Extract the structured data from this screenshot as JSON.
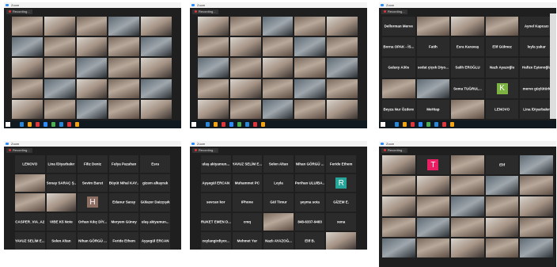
{
  "window_title": "Zoom",
  "recording_label": "Recording...",
  "colors": {
    "zoom_blue": "#2d8cff",
    "record_red": "#e0353b",
    "tile_bg": "#2b2b2b",
    "app_bg": "#1f1f1f"
  },
  "shots": [
    {
      "tiles": [
        {
          "t": "vid"
        },
        {
          "t": "vid",
          "alt": "alt"
        },
        {
          "t": "vid"
        },
        {
          "t": "vid",
          "alt": "dark"
        },
        {
          "t": "vid",
          "alt": "alt"
        },
        {
          "t": "vid",
          "alt": "dark"
        },
        {
          "t": "vid"
        },
        {
          "t": "vid",
          "alt": "alt"
        },
        {
          "t": "vid"
        },
        {
          "t": "vid",
          "alt": "dark"
        },
        {
          "t": "vid",
          "alt": "alt"
        },
        {
          "t": "vid"
        },
        {
          "t": "vid",
          "alt": "dark"
        },
        {
          "t": "vid"
        },
        {
          "t": "vid",
          "alt": "alt"
        },
        {
          "t": "vid"
        },
        {
          "t": "vid",
          "alt": "dark"
        },
        {
          "t": "vid",
          "alt": "alt"
        },
        {
          "t": "vid"
        },
        {
          "t": "vid",
          "alt": "dark"
        },
        {
          "t": "vid",
          "alt": "alt"
        },
        {
          "t": "vid"
        },
        {
          "t": "vid",
          "alt": "dark"
        },
        {
          "t": "vid"
        },
        {
          "t": "vid",
          "alt": "alt"
        }
      ]
    },
    {
      "tiles": [
        {
          "t": "vid",
          "alt": "alt"
        },
        {
          "t": "vid"
        },
        {
          "t": "vid",
          "alt": "dark"
        },
        {
          "t": "vid"
        },
        {
          "t": "vid",
          "alt": "alt"
        },
        {
          "t": "vid"
        },
        {
          "t": "vid",
          "alt": "alt"
        },
        {
          "t": "vid"
        },
        {
          "t": "vid",
          "alt": "dark"
        },
        {
          "t": "vid"
        },
        {
          "t": "vid",
          "alt": "dark"
        },
        {
          "t": "vid"
        },
        {
          "t": "vid",
          "alt": "alt"
        },
        {
          "t": "vid"
        },
        {
          "t": "vid",
          "alt": "dark"
        },
        {
          "t": "vid"
        },
        {
          "t": "vid",
          "alt": "alt"
        },
        {
          "t": "vid"
        },
        {
          "t": "vid",
          "alt": "dark"
        },
        {
          "t": "vid"
        },
        {
          "t": "vid",
          "alt": "alt"
        },
        {
          "t": "vid"
        },
        {
          "t": "vid",
          "alt": "dark"
        },
        {
          "t": "vid"
        },
        {
          "t": "vid",
          "alt": "alt"
        }
      ]
    },
    {
      "tiles": [
        {
          "name": "Dellorman Merve"
        },
        {
          "t": "vid"
        },
        {
          "t": "vid",
          "alt": "alt"
        },
        {
          "t": "vid"
        },
        {
          "name": "Aynel Kapcacı"
        },
        {
          "name": "Borna OPAK - İS..."
        },
        {
          "name": "Fatih"
        },
        {
          "name": "Esra Karavaş"
        },
        {
          "name": "Elif Gülmez"
        },
        {
          "name": "leyla yakar"
        },
        {
          "name": "Galaxy A30s"
        },
        {
          "name": "sedat çiçek Diyo..."
        },
        {
          "name": "Salih EROĞLU"
        },
        {
          "name": "Nazlı Ayazoğlu"
        },
        {
          "name": "Hafize Eştenoğlu"
        },
        {
          "t": "vid"
        },
        {
          "t": "vid",
          "alt": "dark"
        },
        {
          "name": "Sema TUĞRUL..."
        },
        {
          "avatar": "K",
          "color": "#7cb342"
        },
        {
          "name": "merve güçlütürk"
        },
        {
          "name": "Beyza Nur Özdere"
        },
        {
          "name": "MeHtap"
        },
        {
          "t": "vid"
        },
        {
          "name": "LENOVO"
        },
        {
          "name": "Lina /Diyarbakır"
        }
      ]
    },
    {
      "tiles": [
        {
          "name": "LENOVO"
        },
        {
          "name": "Lina /Diyarbakır"
        },
        {
          "name": "Filiz Deniz"
        },
        {
          "name": "Fulya Pazahan"
        },
        {
          "name": "Esra"
        },
        {
          "t": "vid"
        },
        {
          "name": "Sonay SARAÇ Ş..."
        },
        {
          "name": "Sevim Barut"
        },
        {
          "name": "Büyüt Nihal KAY..."
        },
        {
          "name": "gizem alkayrak"
        },
        {
          "t": "vid"
        },
        {
          "t": "vid",
          "alt": "alt"
        },
        {
          "avatar": "H",
          "color": "#8d6e63"
        },
        {
          "name": "Edanur Saray"
        },
        {
          "name": "Gülazer Daizçışık"
        },
        {
          "name": "CASPER_VIA_A2"
        },
        {
          "name": "VIBE K5 Note"
        },
        {
          "name": "Orhan Kılıç DİY..."
        },
        {
          "name": "Meryem Güney"
        },
        {
          "name": "ulaş akiyamun..."
        },
        {
          "name": "YAVUZ SELİM E..."
        },
        {
          "name": "Selen Altan"
        },
        {
          "name": "Nihan GÖRGÜ ..."
        },
        {
          "name": "Feride Ethem"
        },
        {
          "name": "Ayşegül ERCAN"
        }
      ]
    },
    {
      "tiles": [
        {
          "name": "ulaş akiyamun..."
        },
        {
          "name": "YAVUZ SELİM E..."
        },
        {
          "name": "Selen Altan"
        },
        {
          "name": "Nihan GÖRGÜ ..."
        },
        {
          "name": "Feride Ethem"
        },
        {
          "name": "Ayşegül ERCAN"
        },
        {
          "name": "Muhammet PC"
        },
        {
          "name": "Leyla"
        },
        {
          "name": "Perihan ULU/BA..."
        },
        {
          "avatar": "R",
          "color": "#26a69a"
        },
        {
          "name": "sevcan kor"
        },
        {
          "name": "iPhone"
        },
        {
          "name": "Gül Timur"
        },
        {
          "name": "şeyma sota"
        },
        {
          "name": "GİZEM E."
        },
        {
          "name": "RUKET EMEN D..."
        },
        {
          "name": "cmq"
        },
        {
          "t": "vid"
        },
        {
          "name": "848-6337-9483"
        },
        {
          "name": "xena"
        },
        {
          "name": "ceylangirdiyor..."
        },
        {
          "name": "Mehmet Yur"
        },
        {
          "name": "Nazlı AYAZOĞ..."
        },
        {
          "name": "Elif B."
        },
        {
          "t": "vid",
          "alt": "alt"
        }
      ]
    },
    {
      "tiles": [
        {
          "t": "vid",
          "alt": "alt"
        },
        {
          "avatar": "T",
          "color": "#e91e63"
        },
        {
          "t": "vid"
        },
        {
          "name": "Elif"
        },
        {
          "t": "vid",
          "alt": "dark"
        },
        {
          "t": "vid"
        },
        {
          "t": "vid",
          "alt": "alt"
        },
        {
          "t": "vid"
        },
        {
          "t": "vid",
          "alt": "dark"
        },
        {
          "t": "vid"
        },
        {
          "t": "vid",
          "alt": "alt"
        },
        {
          "t": "vid"
        },
        {
          "t": "vid",
          "alt": "dark"
        },
        {
          "t": "vid"
        },
        {
          "t": "vid",
          "alt": "alt"
        },
        {
          "t": "vid"
        },
        {
          "t": "vid",
          "alt": "dark"
        },
        {
          "t": "vid"
        },
        {
          "t": "vid",
          "alt": "alt"
        },
        {
          "t": "vid"
        },
        {
          "t": "vid",
          "alt": "dark"
        },
        {
          "t": "vid"
        },
        {
          "t": "vid",
          "alt": "alt"
        },
        {
          "t": "vid"
        },
        {
          "t": "vid",
          "alt": "dark"
        }
      ]
    }
  ]
}
